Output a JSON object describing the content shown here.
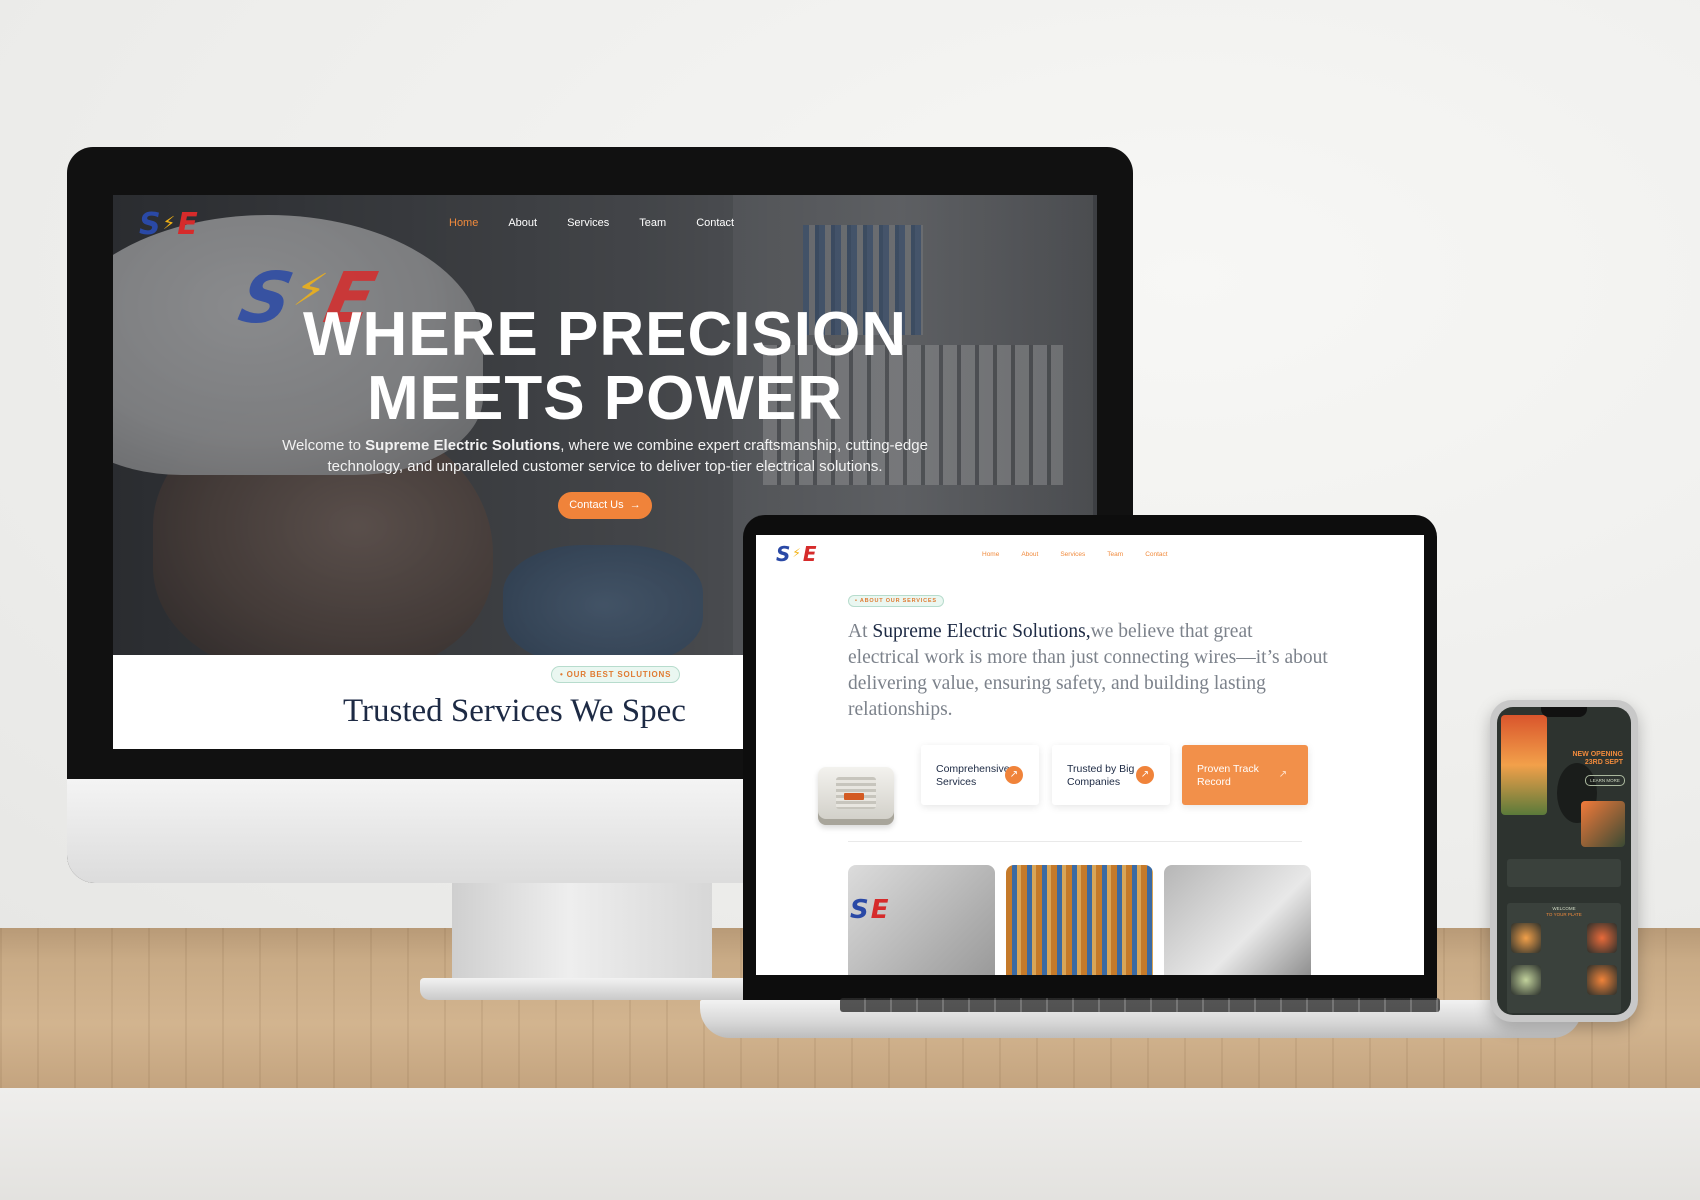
{
  "colors": {
    "accent": "#f08a3c",
    "navy": "#1d2a44",
    "logo_red": "#d62b2b",
    "logo_blue": "#2a49a6",
    "logo_yellow": "#f3b315"
  },
  "brand": {
    "logo_left": "S",
    "logo_right": "E"
  },
  "desktop": {
    "nav": [
      "Home",
      "About",
      "Services",
      "Team",
      "Contact"
    ],
    "active_nav": "Home",
    "hero": {
      "title_line1": "WHERE PRECISION",
      "title_line2": "MEETS POWER",
      "intro_prefix": "Welcome to ",
      "intro_company": "Supreme Electric Solutions",
      "intro_suffix": ", where we combine expert craftsmanship, cutting-edge technology, and unparalleled customer service to deliver top-tier electrical solutions.",
      "cta_label": "Contact Us",
      "cta_icon": "arrow-right-icon"
    },
    "section_badge": "• OUR BEST SOLUTIONS",
    "section_title": "Trusted Services We Spec"
  },
  "laptop": {
    "nav": [
      "Home",
      "About",
      "Services",
      "Team",
      "Contact"
    ],
    "badge": "• ABOUT OUR SERVICES",
    "para_prefix": "At ",
    "para_company": "Supreme Electric Solutions,",
    "para_suffix": "we believe that great electrical work is more than just connecting wires—it’s about delivering value, ensuring safety, and building lasting relationships.",
    "cards": [
      {
        "label": "Comprehensive Services",
        "icon": "arrow-up-right-icon"
      },
      {
        "label": "Trusted by Big Companies",
        "icon": "arrow-up-right-icon"
      },
      {
        "label": "Proven Track Record",
        "icon": "arrow-up-right-icon"
      }
    ]
  },
  "phone": {
    "opening_label": "NEW OPENING",
    "opening_date": "23RD SEPT",
    "button": "LEARN MORE",
    "section_heading_1": "WELCOME",
    "section_heading_2": "TO YOUR PLATE"
  }
}
